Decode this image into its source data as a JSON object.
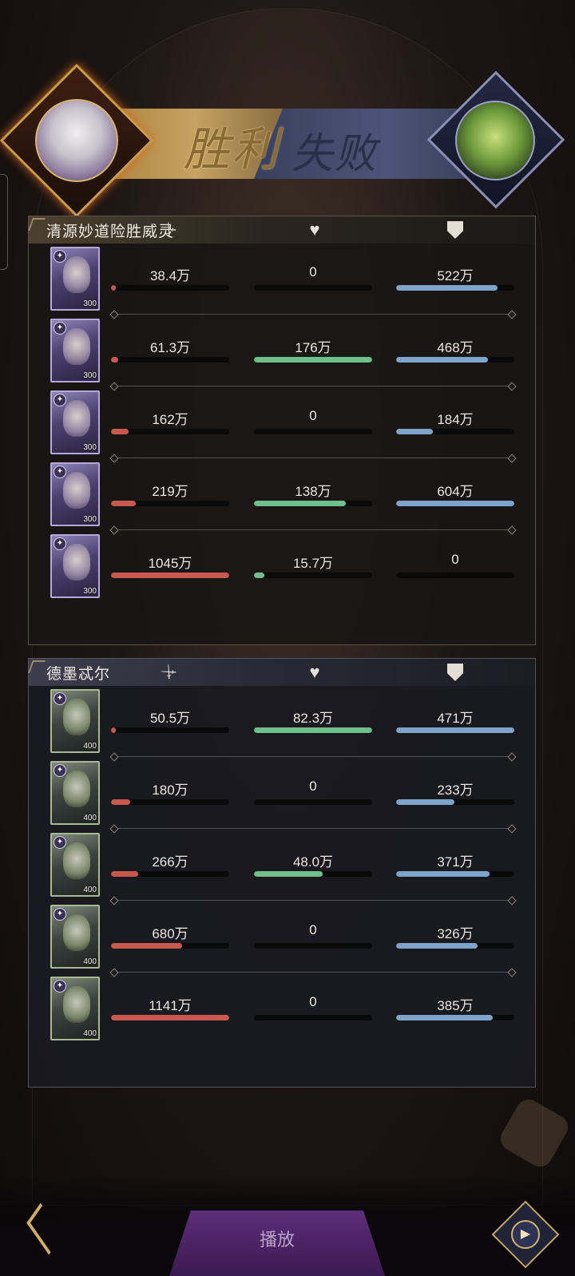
{
  "header": {
    "win_text": "胜利",
    "lose_text": "失败"
  },
  "teams": [
    {
      "name": "清源妙道险胜威灵",
      "members": [
        {
          "level": "300",
          "damage": "38.4万",
          "damage_pct": 0.04,
          "heal": "0",
          "heal_pct": 0,
          "tank": "522万",
          "tank_pct": 0.86
        },
        {
          "level": "300",
          "damage": "61.3万",
          "damage_pct": 0.06,
          "heal": "176万",
          "heal_pct": 1.0,
          "tank": "468万",
          "tank_pct": 0.78
        },
        {
          "level": "300",
          "damage": "162万",
          "damage_pct": 0.15,
          "heal": "0",
          "heal_pct": 0,
          "tank": "184万",
          "tank_pct": 0.31
        },
        {
          "level": "300",
          "damage": "219万",
          "damage_pct": 0.21,
          "heal": "138万",
          "heal_pct": 0.78,
          "tank": "604万",
          "tank_pct": 1.0
        },
        {
          "level": "300",
          "damage": "1045万",
          "damage_pct": 1.0,
          "heal": "15.7万",
          "heal_pct": 0.09,
          "tank": "0",
          "tank_pct": 0
        }
      ]
    },
    {
      "name": "德墨忒尔",
      "members": [
        {
          "level": "400",
          "damage": "50.5万",
          "damage_pct": 0.04,
          "heal": "82.3万",
          "heal_pct": 1.0,
          "tank": "471万",
          "tank_pct": 1.0
        },
        {
          "level": "400",
          "damage": "180万",
          "damage_pct": 0.16,
          "heal": "0",
          "heal_pct": 0,
          "tank": "233万",
          "tank_pct": 0.49
        },
        {
          "level": "400",
          "damage": "266万",
          "damage_pct": 0.23,
          "heal": "48.0万",
          "heal_pct": 0.58,
          "tank": "371万",
          "tank_pct": 0.79
        },
        {
          "level": "400",
          "damage": "680万",
          "damage_pct": 0.6,
          "heal": "0",
          "heal_pct": 0,
          "tank": "326万",
          "tank_pct": 0.69
        },
        {
          "level": "400",
          "damage": "1141万",
          "damage_pct": 1.0,
          "heal": "0",
          "heal_pct": 0,
          "tank": "385万",
          "tank_pct": 0.82
        }
      ]
    }
  ],
  "bottom": {
    "main_button": "播放"
  },
  "icons": {
    "damage": "sword-icon",
    "heal": "heart-icon",
    "tank": "shield-icon"
  }
}
